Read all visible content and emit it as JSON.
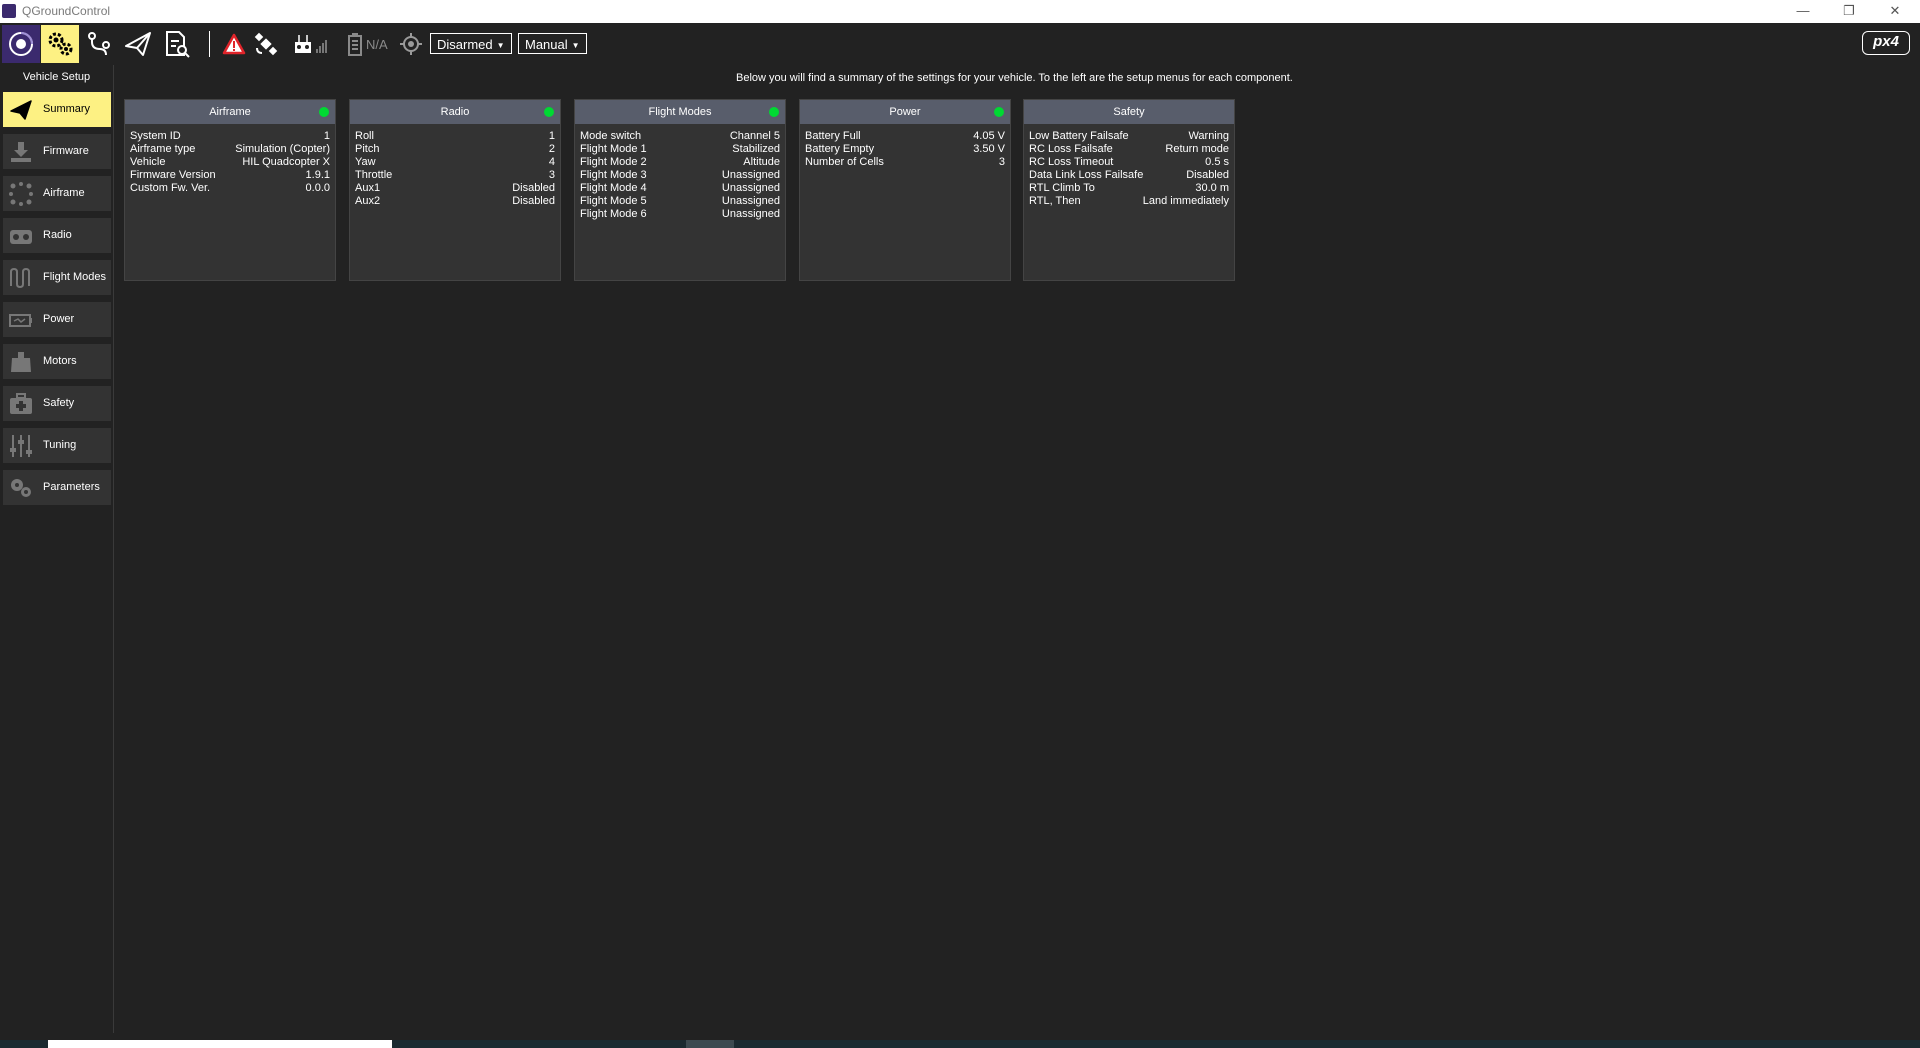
{
  "window": {
    "title": "QGroundControl",
    "controls": {
      "minimize": "—",
      "restore": "❐",
      "close": "✕"
    }
  },
  "toolbar": {
    "buttons": [
      {
        "icon": "qgc-home-icon"
      },
      {
        "icon": "gears-icon"
      },
      {
        "icon": "plan-waypoints-icon"
      },
      {
        "icon": "paper-plane-icon"
      },
      {
        "icon": "log-analyze-icon"
      }
    ],
    "battery_text": "N/A",
    "arm_state": "Disarmed",
    "flight_mode": "Manual",
    "logo": "px4"
  },
  "sidebar": {
    "title": "Vehicle Setup",
    "items": [
      {
        "label": "Summary",
        "icon": "paper-plane-icon",
        "active": true
      },
      {
        "label": "Firmware",
        "icon": "download-icon"
      },
      {
        "label": "Airframe",
        "icon": "airframe-dots-icon"
      },
      {
        "label": "Radio",
        "icon": "radio-transmitter-icon"
      },
      {
        "label": "Flight Modes",
        "icon": "waveform-icon"
      },
      {
        "label": "Power",
        "icon": "battery-icon"
      },
      {
        "label": "Motors",
        "icon": "motor-icon"
      },
      {
        "label": "Safety",
        "icon": "first-aid-icon"
      },
      {
        "label": "Tuning",
        "icon": "sliders-icon"
      },
      {
        "label": "Parameters",
        "icon": "gears-icon"
      }
    ]
  },
  "main": {
    "intro": "Below you will find a summary of the settings for your vehicle. To the left are the setup menus for each component.",
    "cards": [
      {
        "title": "Airframe",
        "status": true,
        "rows": [
          [
            "System ID",
            "1"
          ],
          [
            "Airframe type",
            "Simulation (Copter)"
          ],
          [
            "Vehicle",
            "HIL Quadcopter X"
          ],
          [
            "Firmware Version",
            "1.9.1"
          ],
          [
            "Custom Fw. Ver.",
            "0.0.0"
          ]
        ]
      },
      {
        "title": "Radio",
        "status": true,
        "rows": [
          [
            "Roll",
            "1"
          ],
          [
            "Pitch",
            "2"
          ],
          [
            "Yaw",
            "4"
          ],
          [
            "Throttle",
            "3"
          ],
          [
            "Aux1",
            "Disabled"
          ],
          [
            "Aux2",
            "Disabled"
          ]
        ]
      },
      {
        "title": "Flight Modes",
        "status": true,
        "rows": [
          [
            "Mode switch",
            "Channel 5"
          ],
          [
            "Flight Mode 1",
            "Stabilized"
          ],
          [
            "Flight Mode 2",
            "Altitude"
          ],
          [
            "Flight Mode 3",
            "Unassigned"
          ],
          [
            "Flight Mode 4",
            "Unassigned"
          ],
          [
            "Flight Mode 5",
            "Unassigned"
          ],
          [
            "Flight Mode 6",
            "Unassigned"
          ]
        ]
      },
      {
        "title": "Power",
        "status": true,
        "rows": [
          [
            "Battery Full",
            "4.05 V"
          ],
          [
            "Battery Empty",
            "3.50 V"
          ],
          [
            "Number of Cells",
            "3"
          ]
        ]
      },
      {
        "title": "Safety",
        "status": false,
        "rows": [
          [
            "Low Battery Failsafe",
            "Warning"
          ],
          [
            "RC Loss Failsafe",
            "Return mode"
          ],
          [
            "RC Loss Timeout",
            "0.5 s"
          ],
          [
            "Data Link Loss Failsafe",
            "Disabled"
          ],
          [
            "RTL Climb To",
            "30.0 m"
          ],
          [
            "RTL, Then",
            "Land immediately"
          ]
        ]
      }
    ]
  },
  "colors": {
    "accent_yellow": "#fdf183",
    "status_green": "#00d932",
    "card_header": "#585d6b",
    "card_bg": "#333333",
    "app_bg": "#222222"
  }
}
